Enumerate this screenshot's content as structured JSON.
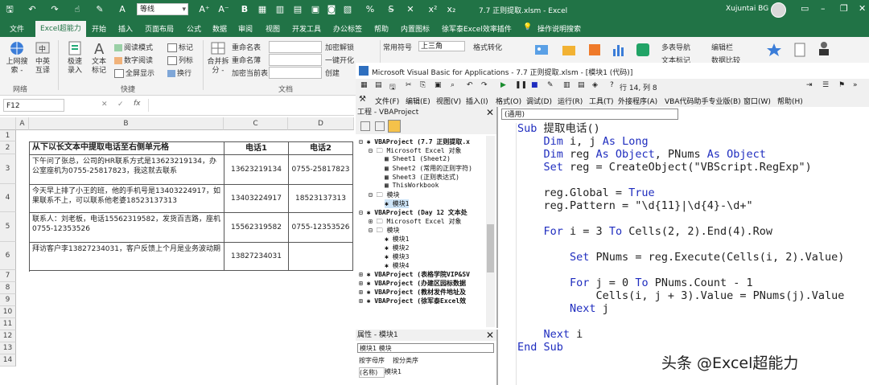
{
  "excel": {
    "font_name": "等线",
    "window_title": "7.7 正则提取.xlsm  -  Excel",
    "user_name": "Xujuntai BG",
    "tabs": [
      "文件",
      "Excel超能力",
      "开始",
      "插入",
      "页面布局",
      "公式",
      "数据",
      "审阅",
      "视图",
      "开发工具",
      "办公标签",
      "帮助",
      "内置图标",
      "徐军泰Excel效率插件"
    ],
    "tell_me": "操作说明搜索"
  },
  "ribbon": {
    "btn_search": "上网搜\n索 -",
    "btn_web": "中英\n互译",
    "grp_web": "网络",
    "btn_quick": "极速\n录入",
    "btn_text": "文本\n标记",
    "read_mode": "阅读模式",
    "digit_read": "数字阅读",
    "fullscreen": "全屏显示",
    "mark": "标记",
    "col_list": "列标",
    "wrap": "换行",
    "grp_quick": "快捷",
    "merge_split": "合并拆\n分 -",
    "rename_sheet": "重命名表",
    "rename_sheet2": "重命名薄",
    "encrypt_table": "加密当前表",
    "grp_doc": "文档",
    "encrypt_unlock": "加密解锁",
    "one_key": "一键开化",
    "create": "创建",
    "common_symbols": "常用符号",
    "triangle": "上三角",
    "formatting": "格式转化",
    "grp_symbol": "格式",
    "multi_nav": "多表导航",
    "edit_bar": "编辑栏",
    "text_mark": "文本标记",
    "data_compare": "数据比较"
  },
  "formula_bar": {
    "cell_ref": "F12",
    "fx": "fx"
  },
  "sheet": {
    "columns": [
      "A",
      "B",
      "C",
      "D"
    ],
    "rows": [
      "1",
      "2",
      "3",
      "4",
      "5",
      "6",
      "7",
      "8",
      "9",
      "10",
      "11",
      "12",
      "13",
      "14"
    ],
    "header": [
      "从下以长文本中提取电话至右侧单元格",
      "电话1",
      "电话2"
    ],
    "data": [
      {
        "text": "下午问了张总，公司的HR联系方式是13623219134，办公室座机为0755-25817823，我这就去联系",
        "phone1": "13623219134",
        "phone2": "0755-25817823"
      },
      {
        "text": "今天早上排了小王的班，他的手机号是13403224917，如果联系不上，可以联系他老婆18523137313",
        "phone1": "13403224917",
        "phone2": "18523137313"
      },
      {
        "text": "联系人：刘老板，电话15562319582，发货百吉路，座机0755-12353526",
        "phone1": "15562319582",
        "phone2": "0755-12353526"
      },
      {
        "text": "拜访客户李13827234031，客户反馈上个月是业务波动期",
        "phone1": "13827234031",
        "phone2": ""
      }
    ]
  },
  "vbe": {
    "title": "Microsoft Visual Basic for Applications - 7.7 正则提取.xlsm - [模块1 (代码)]",
    "position": "行 14, 列 8",
    "menu": [
      "文件(F)",
      "编辑(E)",
      "视图(V)",
      "插入(I)",
      "格式(O)",
      "调试(D)",
      "运行(R)",
      "工具(T)",
      "外接程序(A)",
      "VBA代码助手专业版(B)",
      "窗口(W)",
      "帮助(H)"
    ],
    "project_title": "工程 - VBAProject",
    "tree": [
      "VBAProject (7.7 正则提取.x",
      "Microsoft Excel 对象",
      "Sheet1 (Sheet2)",
      "Sheet2 (常用的正则字符)",
      "Sheet3 (正则表达式)",
      "ThisWorkbook",
      "模块",
      "模块1",
      "VBAProject (Day 12 文本处",
      "Microsoft Excel 对象",
      "模块",
      "模块1",
      "模块2",
      "模块3",
      "模块4",
      "VBAProject (表格学院VIP&SV",
      "VBAProject (办建区园标数据",
      "VBAProject (教材发件地址及",
      "VBAProject (徐军泰Excel效"
    ],
    "props_title": "属性 - 模块1",
    "props_select": "模块1 模块",
    "props_tabs": [
      "按字母序",
      "按分类序"
    ],
    "props_name_key": "(名称)",
    "props_name_val": "模块1",
    "proc_dropdown": "(通用)",
    "code": [
      "Sub 提取电话()",
      "    Dim i, j As Long",
      "    Dim reg As Object, PNums As Object",
      "    Set reg = CreateObject(\"VBScript.RegExp\")",
      "",
      "    reg.Global = True",
      "    reg.Pattern = \"\\d{11}|\\d{4}-\\d+\"",
      "",
      "    For i = 3 To Cells(2, 2).End(4).Row",
      "",
      "        Set PNums = reg.Execute(Cells(i, 2).Value)",
      "",
      "        For j = 0 To PNums.Count - 1",
      "            Cells(i, j + 3).Value = PNums(j).Value",
      "        Next j",
      "",
      "    Next i",
      "End Sub"
    ]
  },
  "watermark": "头条 @Excel超能力",
  "colors": {
    "excel_green": "#217346",
    "vba_keyword": "#1f2dbf"
  }
}
